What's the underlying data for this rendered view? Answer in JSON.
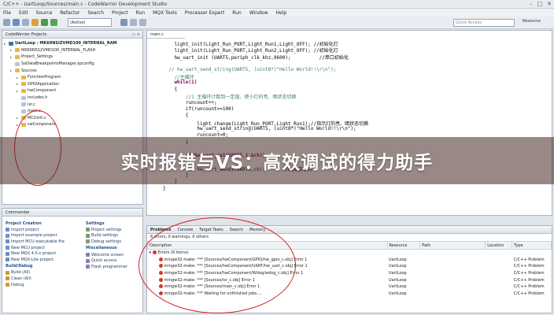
{
  "window": {
    "title": "C/C++ - UartLoop/Sources/main.c - CodeWarrior Development Studio",
    "controls": [
      "–",
      "□",
      "✕"
    ]
  },
  "menu": [
    "File",
    "Edit",
    "Source",
    "Refactor",
    "Search",
    "Project",
    "Run",
    "MQX Tools",
    "Processor Expert",
    "Run",
    "Window",
    "Help"
  ],
  "toolbar": {
    "build_config": "(Active)",
    "quick_access_placeholder": "Quick Access",
    "perspective": "Resource"
  },
  "project_explorer": {
    "tab_label": "CodeWarrior Projects",
    "rows": [
      {
        "indent": 0,
        "icon": "project",
        "label": "UartLoop : MK60NSIZVMD100_INTERNAL_RAM",
        "bold": true
      },
      {
        "indent": 1,
        "icon": "folder",
        "label": "MK60N512VMD100_INTERNAL_FLASH"
      },
      {
        "indent": 1,
        "icon": "folder",
        "label": "Project_Settings"
      },
      {
        "indent": 1,
        "icon": "file",
        "label": "SaDataBreakpointsManager.xpconfig"
      },
      {
        "indent": 1,
        "icon": "folder",
        "label": "Sources"
      },
      {
        "indent": 2,
        "icon": "folder",
        "label": "FunctionProgram"
      },
      {
        "indent": 2,
        "icon": "folder",
        "label": "GPIOApplication"
      },
      {
        "indent": 2,
        "icon": "folder",
        "label": "hwComponent"
      },
      {
        "indent": 2,
        "icon": "file",
        "label": "includes.h"
      },
      {
        "indent": 2,
        "icon": "file",
        "label": "isr.c"
      },
      {
        "indent": 2,
        "icon": "file",
        "label": "main.c"
      },
      {
        "indent": 2,
        "icon": "folder",
        "label": "MCUinit.c"
      },
      {
        "indent": 2,
        "icon": "folder",
        "label": "swComponent"
      }
    ]
  },
  "editor": {
    "tab_label": "main.c",
    "lines": [
      {
        "text": "    light_init(Light_Run_PORT,Light_Run1,Light_OFF); //初始化灯",
        "cls": "fn"
      },
      {
        "text": "    light_init(Light_Run_PORT,Light_Run2,Light_OFF); //初始化灯",
        "cls": "fn"
      },
      {
        "text": "    hw_uart_init (UART5,periph_clk_khz,9600);          //串口初始化",
        "cls": "fn"
      },
      {
        "text": "",
        "cls": "fn"
      },
      {
        "text": "  // hw_uart_send_string(UART5, (uint8*)\"Hello World!!\\r\\n\");",
        "cls": "cmt"
      },
      {
        "text": "    //主循环",
        "cls": "cmt"
      },
      {
        "text": "    while(1)",
        "cls": "kw"
      },
      {
        "text": "    {",
        "cls": "fn"
      },
      {
        "text": "        //1 主循环计数到一定值，使小灯的亮、暗状态切换",
        "cls": "cmt"
      },
      {
        "text": "        runcount++;",
        "cls": "fn"
      },
      {
        "text": "        if(runcount>=100)",
        "cls": "fn"
      },
      {
        "text": "        {",
        "cls": "fn"
      },
      {
        "text": "            light_change(Light_Run_PORT,Light_Run1);//指示灯的亮、暗状态切换",
        "cls": "fn"
      },
      {
        "text": "            hw_uart_send_string(UART5, (uint8*)\"Hello World!!\\r\\n\");",
        "cls": "fn"
      },
      {
        "text": "            runcount=0;",
        "cls": "fn"
      },
      {
        "text": "        }",
        "cls": "fn"
      },
      {
        "text": "        ",
        "cls": "fn"
      },
      {
        "text": "        if(hw_uart_re1(UART5,1,&ch))",
        "cls": "kw"
      },
      {
        "text": "        {",
        "cls": "fn"
      },
      {
        "text": "            hw_uart_send1(UART5,ch);      //回发接收到",
        "cls": "fn"
      },
      {
        "text": "        }",
        "cls": "fn"
      },
      {
        "text": "    }",
        "cls": "fn"
      },
      {
        "text": "}",
        "cls": "fn"
      }
    ]
  },
  "commander": {
    "tab_label": "Commander",
    "project_creation": {
      "title": "Project Creation",
      "items": [
        "Import project",
        "Import example project",
        "Import MCU executable file",
        "New MCU project",
        "New MQX 4.0.x project",
        "New MQX-Lite project"
      ]
    },
    "build_debug": {
      "title": "Build/Debug",
      "items": [
        "Build (All)",
        "Clean (All)",
        "Debug"
      ]
    },
    "settings": {
      "title": "Settings",
      "items": [
        "Project settings",
        "Build settings",
        "Debug settings"
      ]
    },
    "misc": {
      "title": "Miscellaneous",
      "items": [
        "Welcome screen",
        "Quick access",
        "Flash programmer"
      ]
    }
  },
  "problems": {
    "tabs": [
      "Problems",
      "Console",
      "Target Tasks",
      "Search",
      "Memory"
    ],
    "summary": "6 errors, 0 warnings, 0 others",
    "columns": [
      "Description",
      "Resource",
      "Path",
      "Location",
      "Type"
    ],
    "group": "Errors (6 items)",
    "rows": [
      {
        "desc": "mingw32-make: *** [Sources/hwComponent/GPIO/hw_gpio_c.obj] Error 1",
        "resource": "UartLoop",
        "path": "",
        "location": "",
        "type": "C/C++ Problem"
      },
      {
        "desc": "mingw32-make: *** [Sources/hwComponent/UART/hw_uart_c.obj] Error 1",
        "resource": "UartLoop",
        "path": "",
        "location": "",
        "type": "C/C++ Problem"
      },
      {
        "desc": "mingw32-make: *** [Sources/hwComponent/Wdog/wdog_c.obj] Error 1",
        "resource": "UartLoop",
        "path": "",
        "location": "",
        "type": "C/C++ Problem"
      },
      {
        "desc": "mingw32-make: *** [Sources/isr_c.obj] Error 1",
        "resource": "UartLoop",
        "path": "",
        "location": "",
        "type": "C/C++ Problem"
      },
      {
        "desc": "mingw32-make: *** [Sources/main_c.obj] Error 1",
        "resource": "UartLoop",
        "path": "",
        "location": "",
        "type": "C/C++ Problem"
      },
      {
        "desc": "mingw32-make: *** Waiting for unfinished jobs....",
        "resource": "UartLoop",
        "path": "",
        "location": "",
        "type": "C/C++ Problem"
      }
    ]
  },
  "banner": {
    "text": "实时报错与VS：高效调试的得力助手"
  }
}
